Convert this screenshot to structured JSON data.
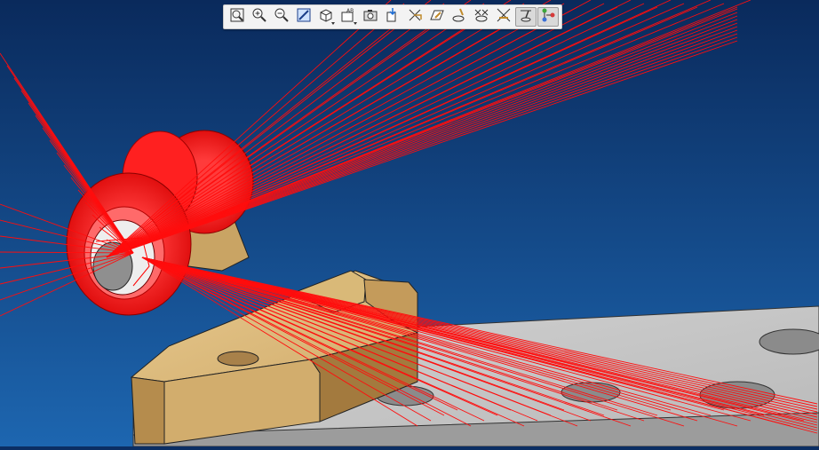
{
  "window": {
    "title": ""
  },
  "scene": {
    "background_top": "#0a2a5c",
    "background_bottom": "#1d66b0",
    "part_color": "#d7b478",
    "plate_color": "#c3c3c3",
    "highlight_color": "#ff1a1a"
  },
  "toolbar": {
    "buttons": [
      {
        "id": "fit-all",
        "icon": "fit-all-icon",
        "active": false
      },
      {
        "id": "zoom-in",
        "icon": "zoom-in-icon",
        "active": false
      },
      {
        "id": "zoom-out",
        "icon": "zoom-out-icon",
        "active": false
      },
      {
        "id": "normal-view",
        "icon": "normal-view-icon",
        "active": false
      },
      {
        "id": "iso-view",
        "icon": "iso-view-icon",
        "active": false,
        "dropdown": true
      },
      {
        "id": "named-views",
        "icon": "named-views-icon",
        "active": false,
        "dropdown": true
      },
      {
        "id": "capture",
        "icon": "camera-icon",
        "active": false
      },
      {
        "id": "hide-show",
        "icon": "hide-show-icon",
        "active": false
      },
      {
        "id": "swap-space",
        "icon": "swap-space-icon",
        "active": false
      },
      {
        "id": "sketch-plane",
        "icon": "sketch-plane-icon",
        "active": false
      },
      {
        "id": "measure-item",
        "icon": "measure-item-icon",
        "active": false
      },
      {
        "id": "clash",
        "icon": "clash-icon",
        "active": false
      },
      {
        "id": "sectioning",
        "icon": "sectioning-icon",
        "active": false
      },
      {
        "id": "compass-toggle",
        "icon": "compass-toggle-icon",
        "active": true
      },
      {
        "id": "tree-toggle",
        "icon": "tree-toggle-icon",
        "active": true
      }
    ]
  }
}
